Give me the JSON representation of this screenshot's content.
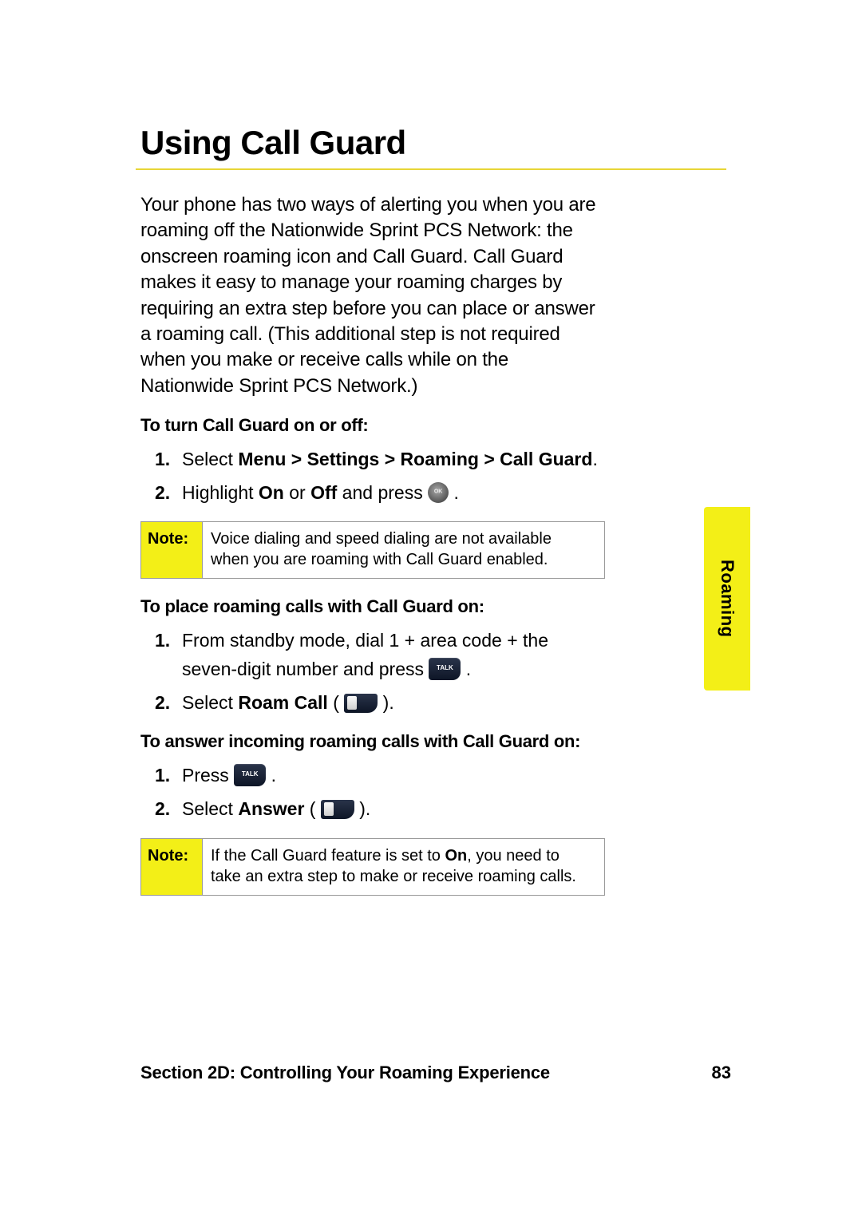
{
  "title": "Using Call Guard",
  "intro": "Your phone has two ways of alerting you when you are roaming off the Nationwide Sprint PCS Network: the onscreen roaming icon and Call Guard. Call Guard makes it easy to manage your roaming charges by requiring an extra step before you can place or answer a roaming call. (This additional step is not required when you make or receive calls while on the Nationwide Sprint PCS Network.)",
  "sub1": "To turn Call Guard on or off:",
  "step1a_prefix": "Select ",
  "step1a_path": "Menu > Settings > Roaming > Call Guard",
  "step1a_suffix": ".",
  "step1b_p1": "Highlight ",
  "step1b_on": "On",
  "step1b_mid": " or ",
  "step1b_off": "Off",
  "step1b_p2": " and press ",
  "step1b_end": " .",
  "note_label": "Note:",
  "note1": "Voice dialing and speed dialing are not available when you are roaming with Call Guard enabled.",
  "sub2": "To place roaming calls with Call Guard on:",
  "step2a_p1": "From standby mode, dial 1 + area code + the seven-digit number and press ",
  "step2a_end": " .",
  "step2b_p1": "Select ",
  "step2b_bold": "Roam Call",
  "step2b_p2": " ( ",
  "step2b_end": " ).",
  "sub3": "To answer incoming roaming calls with Call Guard on:",
  "step3a_p1": "Press ",
  "step3a_end": " .",
  "step3b_p1": "Select ",
  "step3b_bold": "Answer",
  "step3b_p2": " ( ",
  "step3b_end": " ).",
  "note2_p1": "If the Call Guard feature is set to ",
  "note2_bold": "On",
  "note2_p2": ", you need to take an extra step to make or receive roaming calls.",
  "side_tab": "Roaming",
  "footer_section": "Section 2D: Controlling Your Roaming Experience",
  "footer_page": "83"
}
